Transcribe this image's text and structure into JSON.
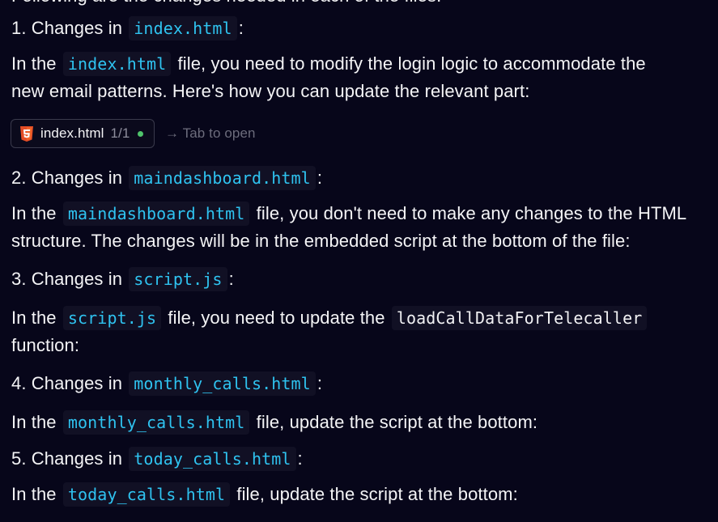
{
  "top_partial": "Following are the changes needed in each of the files:",
  "sections": [
    {
      "heading_prefix": "1. Changes in",
      "heading_file": "index.html",
      "heading_suffix": ":",
      "body_prefix": "In the",
      "body_file": "index.html",
      "body_line1": "file, you need to modify the login logic to accommodate the",
      "body_line2": "new email patterns. Here's how you can update the relevant part:"
    },
    {
      "heading_prefix": "2. Changes in",
      "heading_file": "maindashboard.html",
      "heading_suffix": ":",
      "body_prefix": "In the",
      "body_file": "maindashboard.html",
      "body_line1": "file, you don't need to make any changes to the HTML",
      "body_line2": "structure. The changes will be in the embedded script at the bottom of the file:"
    },
    {
      "heading_prefix": "3. Changes in",
      "heading_file": "script.js",
      "heading_suffix": ":",
      "body_prefix": "In the",
      "body_file": "script.js",
      "body_line1": "file, you need to update the",
      "body_code": "loadCallDataForTelecaller",
      "body_line2": "function:"
    },
    {
      "heading_prefix": "4. Changes in",
      "heading_file": "monthly_calls.html",
      "heading_suffix": ":",
      "body_prefix": "In the",
      "body_file": "monthly_calls.html",
      "body_line1": "file, update the script at the bottom:"
    },
    {
      "heading_prefix": "5. Changes in",
      "heading_file": "today_calls.html",
      "heading_suffix": ":",
      "body_prefix": "In the",
      "body_file": "today_calls.html",
      "body_line1": "file, update the script at the bottom:"
    }
  ],
  "file_chip": {
    "icon": "html5-icon",
    "name": "index.html",
    "count": "1/1",
    "status_color": "#4fc46b",
    "hint": "→ Tab to open"
  },
  "colors": {
    "background": "#07061a",
    "text": "#f4f4f6",
    "code_link": "#2fc3f0",
    "code_bg": "#111024"
  }
}
